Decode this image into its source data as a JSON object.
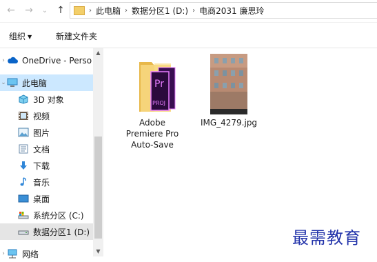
{
  "nav": {
    "back_icon": "back-arrow-icon",
    "forward_icon": "forward-arrow-icon",
    "recent_icon": "chevron-down-icon",
    "up_icon": "up-arrow-icon"
  },
  "address": {
    "crumbs": [
      "此电脑",
      "数据分区1 (D:)",
      "电商2031 廉思玲"
    ]
  },
  "ribbon": {
    "organize": "组织",
    "new_folder": "新建文件夹"
  },
  "sidebar": {
    "items": [
      {
        "label": "OneDrive - Perso",
        "icon": "onedrive-cloud-icon"
      },
      {
        "label": "此电脑",
        "icon": "pc-icon"
      },
      {
        "label": "3D 对象",
        "icon": "3d-objects-icon"
      },
      {
        "label": "视频",
        "icon": "video-icon"
      },
      {
        "label": "图片",
        "icon": "pictures-icon"
      },
      {
        "label": "文档",
        "icon": "documents-icon"
      },
      {
        "label": "下载",
        "icon": "download-icon"
      },
      {
        "label": "音乐",
        "icon": "music-icon"
      },
      {
        "label": "桌面",
        "icon": "desktop-icon"
      },
      {
        "label": "系统分区 (C:)",
        "icon": "system-drive-icon"
      },
      {
        "label": "数据分区1 (D:)",
        "icon": "drive-icon"
      },
      {
        "label": "网络",
        "icon": "network-icon"
      }
    ]
  },
  "files": [
    {
      "name_lines": [
        "Adobe",
        "Premiere Pro",
        "Auto-Save"
      ],
      "icon": "premiere-folder-icon"
    },
    {
      "name_lines": [
        "IMG_4279.jpg"
      ],
      "icon": "image-thumbnail"
    }
  ],
  "watermark": "最需教育",
  "colors": {
    "selected": "#cce8ff",
    "folder": "#f3cf6a",
    "premiere": "#2b0a3d",
    "premiere_accent": "#e77cff",
    "watermark": "#2233aa"
  }
}
